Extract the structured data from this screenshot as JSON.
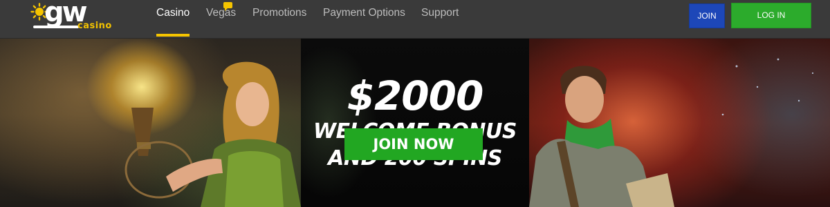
{
  "brand": {
    "logo_word": "gw",
    "logo_sub": "casino",
    "colors": {
      "accent": "#f5c400",
      "header_bg": "#3a3a3a",
      "join_blue": "#1d47b8",
      "login_green": "#2cab2c"
    }
  },
  "nav": {
    "items": [
      {
        "label": "Casino",
        "active": true
      },
      {
        "label": "Vegas",
        "active": false
      },
      {
        "label": "Promotions",
        "active": false
      },
      {
        "label": "Payment Options",
        "active": false
      },
      {
        "label": "Support",
        "active": false
      }
    ]
  },
  "auth": {
    "join_label": "JOIN",
    "login_label": "LOG IN"
  },
  "hero": {
    "amount": "$2000",
    "line1": "WELCOME BONUS",
    "line2": "AND 200 SPINS",
    "cta_label": "JOIN NOW",
    "cta_color": "#22a722"
  },
  "icons": {
    "logo_mark": "sun-icon",
    "vegas_badge": "chat-bubble-icon"
  }
}
